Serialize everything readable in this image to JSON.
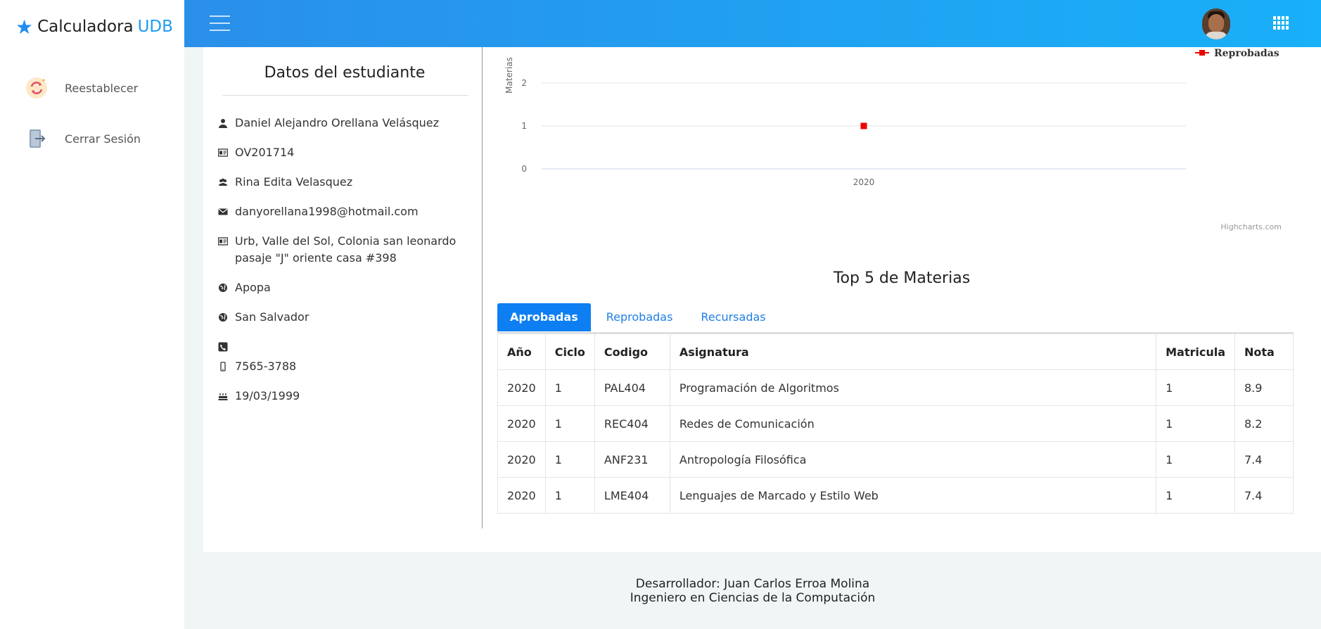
{
  "brand": {
    "name": "Calculadora",
    "suffix": "UDB"
  },
  "sidebar": {
    "items": [
      {
        "label": "Reestablecer",
        "icon": "reset-icon"
      },
      {
        "label": "Cerrar Sesión",
        "icon": "logout-icon"
      }
    ]
  },
  "header": {
    "menu_icon": "hamburger-icon",
    "avatar": "user-avatar",
    "apps_icon": "apps-grid-icon"
  },
  "student": {
    "title": "Datos del estudiante",
    "name": "Daniel Alejandro Orellana Velásquez",
    "carnet": "OV201714",
    "guardian": "Rina Edita Velasquez",
    "email": "danyorellana1998@hotmail.com",
    "address_line1": "Urb, Valle del Sol, Colonia san leonardo",
    "address_line2": "pasaje \"J\" oriente casa #398",
    "municipality": "Apopa",
    "department": "San Salvador",
    "phone": "",
    "mobile": "7565-3788",
    "birthdate": "19/03/1999"
  },
  "chart_data": {
    "type": "line",
    "x": [
      "2020"
    ],
    "series": [
      {
        "name": "Reprobadas",
        "values": [
          1
        ],
        "color": "#ee0000"
      }
    ],
    "ylabel": "Materias",
    "yticks": [
      "0",
      "1",
      "2",
      "3"
    ],
    "ylim": [
      0,
      3
    ],
    "legend": "top-right",
    "grid": true,
    "credit": "Highcharts.com"
  },
  "top5": {
    "title": "Top 5 de Materias",
    "tabs": [
      "Aprobadas",
      "Reprobadas",
      "Recursadas"
    ],
    "active_tab": "Aprobadas",
    "columns": [
      "Año",
      "Ciclo",
      "Codigo",
      "Asignatura",
      "Matricula",
      "Nota"
    ],
    "rows": [
      [
        "2020",
        "1",
        "PAL404",
        "Programación de Algoritmos",
        "1",
        "8.9"
      ],
      [
        "2020",
        "1",
        "REC404",
        "Redes de Comunicación",
        "1",
        "8.2"
      ],
      [
        "2020",
        "1",
        "ANF231",
        "Antropología Filosófica",
        "1",
        "7.4"
      ],
      [
        "2020",
        "1",
        "LME404",
        "Lenguajes de Marcado y Estilo Web",
        "1",
        "7.4"
      ]
    ]
  },
  "footer": {
    "line1": "Desarrollador: Juan Carlos Erroa Molina",
    "line2": "Ingeniero en Ciencias de la Computación"
  },
  "colors": {
    "accent": "#0d7ff2",
    "header_start": "#2a8fe9",
    "header_end": "#18b0f8",
    "fail": "#ee0000"
  }
}
